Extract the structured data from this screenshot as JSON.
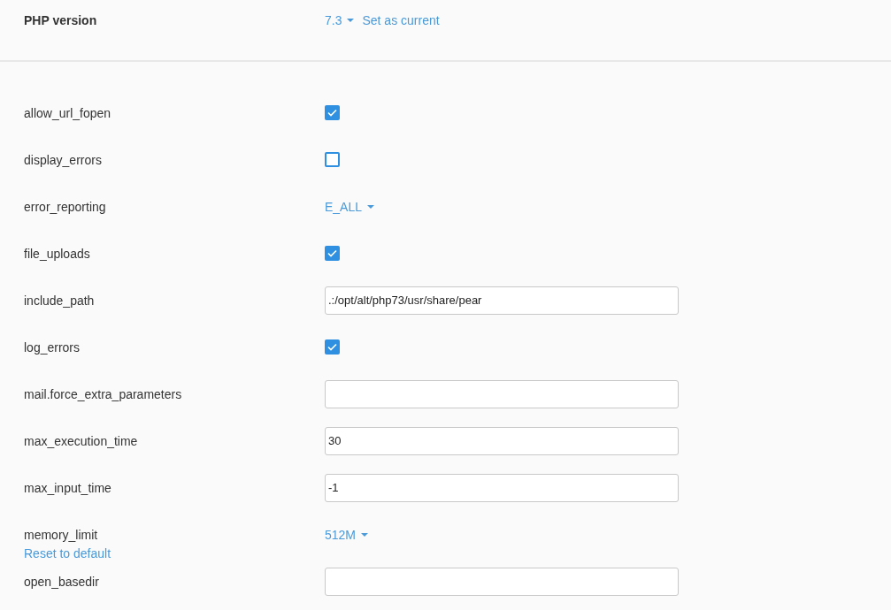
{
  "php_version": {
    "label": "PHP version",
    "version": "7.3",
    "set_current": "Set as current"
  },
  "options": [
    {
      "name": "allow_url_fopen",
      "kind": "checkbox",
      "checked": true
    },
    {
      "name": "display_errors",
      "kind": "checkbox",
      "checked": false
    },
    {
      "name": "error_reporting",
      "kind": "dropdown",
      "value": "E_ALL"
    },
    {
      "name": "file_uploads",
      "kind": "checkbox",
      "checked": true
    },
    {
      "name": "include_path",
      "kind": "text",
      "value": ".:/opt/alt/php73/usr/share/pear"
    },
    {
      "name": "log_errors",
      "kind": "checkbox",
      "checked": true
    },
    {
      "name": "mail.force_extra_parameters",
      "kind": "text"
    },
    {
      "name": "max_execution_time",
      "kind": "text",
      "value": "30"
    },
    {
      "name": "max_input_time",
      "kind": "text",
      "value": "-1"
    },
    {
      "name": "memory_limit",
      "kind": "dropdown",
      "value": "512M",
      "reset": "Reset to default"
    },
    {
      "name": "open_basedir",
      "kind": "text"
    }
  ]
}
